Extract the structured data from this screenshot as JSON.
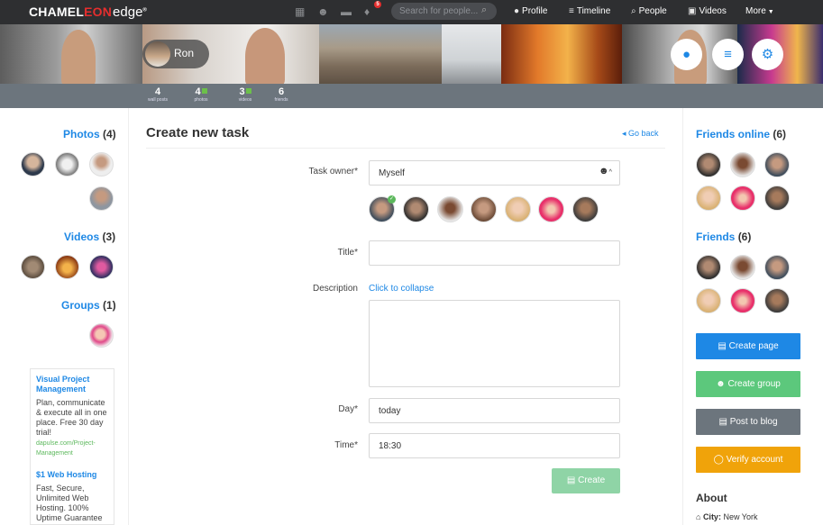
{
  "brand": {
    "name_a": "CHAMEL",
    "name_o": "EON",
    "name_b": "edge",
    "mark": "®"
  },
  "topbar": {
    "badge_count": "5",
    "search_placeholder": "Search for people...",
    "nav": [
      "Profile",
      "Timeline",
      "People",
      "Videos",
      "More"
    ]
  },
  "profile": {
    "name": "Ron",
    "stats": [
      {
        "value": "4",
        "label": "wall posts"
      },
      {
        "value": "4",
        "label": "photos"
      },
      {
        "value": "3",
        "label": "videos"
      },
      {
        "value": "6",
        "label": "friends"
      }
    ]
  },
  "left": {
    "photos": {
      "title": "Photos",
      "count": "(4)"
    },
    "videos": {
      "title": "Videos",
      "count": "(3)"
    },
    "groups": {
      "title": "Groups",
      "count": "(1)"
    },
    "ads": [
      {
        "title": "Visual Project Management",
        "body": "Plan, communicate & execute all in one place. Free 30 day trial!",
        "link": "dapulse.com/Project-Management"
      },
      {
        "title": "$1 Web Hosting",
        "body": "Fast, Secure, Unlimited Web Hosting. 100% Uptime Guarantee",
        "link": ""
      }
    ]
  },
  "main": {
    "title": "Create new task",
    "go_back": "Go back",
    "owner_label": "Task owner*",
    "owner_value": "Myself",
    "title_label": "Title*",
    "title_value": "",
    "desc_label": "Description",
    "desc_link": "Click to collapse",
    "desc_value": "",
    "day_label": "Day*",
    "day_value": "today",
    "time_label": "Time*",
    "time_value": "18:30",
    "create_label": "Create"
  },
  "right": {
    "friends_online": {
      "title": "Friends online",
      "count": "(6)"
    },
    "friends": {
      "title": "Friends",
      "count": "(6)"
    },
    "buttons": [
      "Create page",
      "Create group",
      "Post to blog",
      "Verify account"
    ],
    "about_title": "About",
    "city_label": "City:",
    "city_value": "New York"
  },
  "colors": {
    "accent": "#1e88e5",
    "topbar": "#2e2f31",
    "stats_bar": "#6c757d",
    "green": "#5cb85c",
    "gray_btn": "#6c757d",
    "amber": "#f0a30a"
  }
}
